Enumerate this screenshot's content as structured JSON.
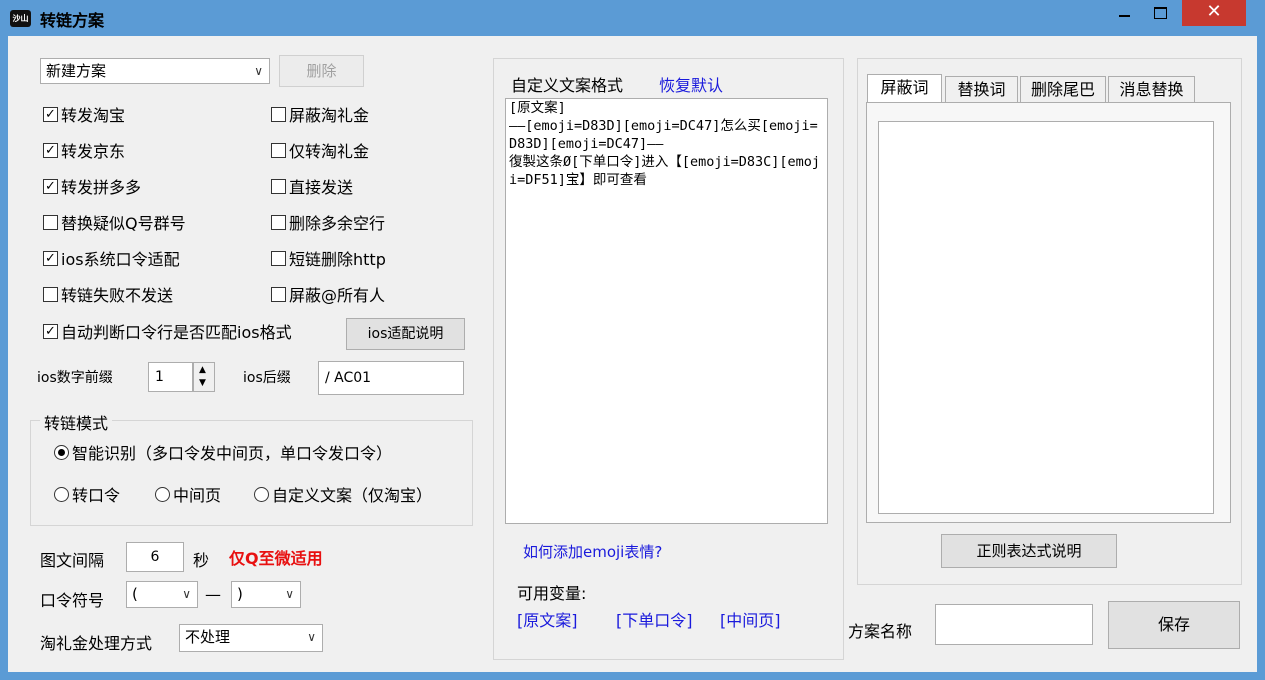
{
  "window": {
    "title": "转链方案",
    "app_icon_text": "沙山"
  },
  "left": {
    "scheme_select": "新建方案",
    "delete_label": "删除",
    "checkboxes": [
      {
        "label": "转发淘宝",
        "checked": true
      },
      {
        "label": "屏蔽淘礼金",
        "checked": false
      },
      {
        "label": "转发京东",
        "checked": true
      },
      {
        "label": "仅转淘礼金",
        "checked": false
      },
      {
        "label": "转发拼多多",
        "checked": true
      },
      {
        "label": "直接发送",
        "checked": false
      },
      {
        "label": "替换疑似Q号群号",
        "checked": false
      },
      {
        "label": "删除多余空行",
        "checked": false
      },
      {
        "label": "ios系统口令适配",
        "checked": true
      },
      {
        "label": "短链删除http",
        "checked": false
      },
      {
        "label": "转链失败不发送",
        "checked": false
      },
      {
        "label": "屏蔽@所有人",
        "checked": false
      },
      {
        "label": "自动判断口令行是否匹配ios格式",
        "checked": true
      }
    ],
    "ios_help_label": "ios适配说明",
    "ios_prefix_label": "ios数字前缀",
    "ios_prefix_value": "1",
    "ios_suffix_label": "ios后缀",
    "ios_suffix_value": "/ AC01",
    "mode_group_title": "转链模式",
    "mode_options": [
      {
        "label": "智能识别（多口令发中间页，单口令发口令）",
        "selected": true
      },
      {
        "label": "转口令",
        "selected": false
      },
      {
        "label": "中间页",
        "selected": false
      },
      {
        "label": "自定义文案（仅淘宝）",
        "selected": false
      }
    ],
    "interval_label": "图文间隔",
    "interval_value": "6",
    "interval_unit": "秒",
    "interval_note": "仅Q至微适用",
    "token_label": "口令符号",
    "token_left": "(",
    "token_dash": "—",
    "token_right": ")",
    "tlj_label": "淘礼金处理方式",
    "tlj_value": "不处理"
  },
  "middle": {
    "title": "自定义文案格式",
    "restore_label": "恢复默认",
    "template_text": "[原文案]\n——[emoji=D83D][emoji=DC47]怎么买[emoji=D83D][emoji=DC47]——\n復製这条Ø[下单口令]进入【[emoji=D83C][emoji=DF51]宝】即可查看",
    "emoji_help_link": "如何添加emoji表情?",
    "vars_label": "可用变量:",
    "vars": [
      "[原文案]",
      "[下单口令]",
      "[中间页]"
    ]
  },
  "right": {
    "tabs": [
      "屏蔽词",
      "替换词",
      "删除尾巴",
      "消息替换"
    ],
    "active_tab": 0,
    "regex_help_label": "正则表达式说明",
    "scheme_name_label": "方案名称",
    "scheme_name_value": "",
    "save_label": "保存"
  },
  "colors": {
    "titlebar": "#5b9bd5",
    "close_button": "#c7392f",
    "link": "#1a1adc",
    "note_red": "#e81010"
  }
}
